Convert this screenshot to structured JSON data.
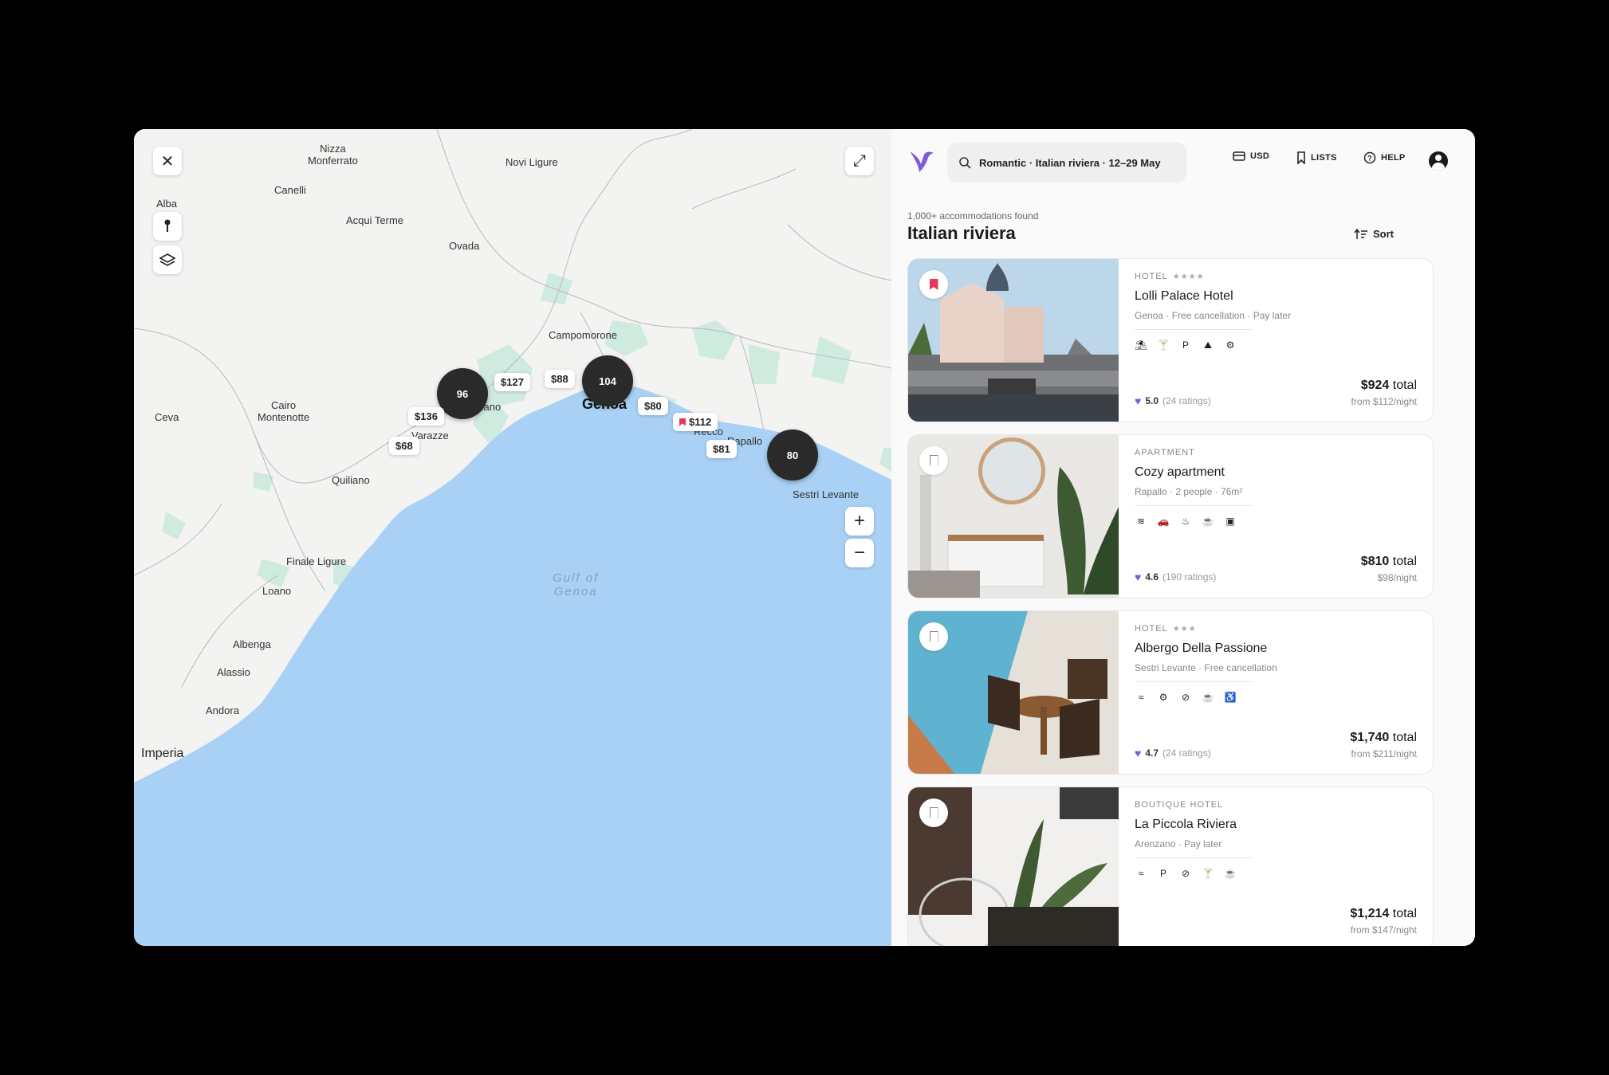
{
  "map": {
    "labels": {
      "nizza": "Nizza\nMonferrato",
      "novi": "Novi Ligure",
      "canelli": "Canelli",
      "alba": "Alba",
      "acqui": "Acqui Terme",
      "ovada": "Ovada",
      "campomorone": "Campomorone",
      "cairo": "Cairo\nMontenotte",
      "ceva": "Ceva",
      "arenzano": "zano",
      "varazze": "Varazze",
      "genoa": "Genoa",
      "recco": "Recco",
      "rapallo": "Rapallo",
      "sestri": "Sestri Levante",
      "quiliano": "Quiliano",
      "finale": "Finale Ligure",
      "loano": "Loano",
      "albenga": "Albenga",
      "alassio": "Alassio",
      "andora": "Andora",
      "imperia": "Imperia",
      "gulf": "Gulf of\nGenoa"
    },
    "clusters": [
      "96",
      "104",
      "80"
    ],
    "prices": [
      "$127",
      "$88",
      "$80",
      "$112",
      "$136",
      "$68",
      "$81"
    ],
    "controls": {
      "close": "✕",
      "expand": "⤢",
      "zoom_in": "+",
      "zoom_out": "−"
    }
  },
  "topbar": {
    "search": "Romantic · Italian riviera · 12–29 May",
    "currency": "USD",
    "lists": "LISTS",
    "help": "HELP"
  },
  "results": {
    "count": "1,000+ accommodations found",
    "region": "Italian riviera",
    "sort": "Sort"
  },
  "listings": [
    {
      "type": "HOTEL",
      "stars": "★★★★",
      "name": "Lolli Palace Hotel",
      "meta": "Genoa · Free cancellation · Pay later",
      "amenities": [
        "⛱",
        "🍸",
        "P",
        "⛰",
        "⚙"
      ],
      "score": "5.0",
      "ratings": "(24 ratings)",
      "total": "$924",
      "total_suffix": "total",
      "night": "from $112/night",
      "saved": true
    },
    {
      "type": "APARTMENT",
      "stars": "",
      "name": "Cozy apartment",
      "meta": "Rapallo · 2 people · 76m²",
      "amenities": [
        "≋",
        "🚗",
        "♨",
        "☕",
        "▣"
      ],
      "score": "4.6",
      "ratings": "(190 ratings)",
      "total": "$810",
      "total_suffix": "total",
      "night": "$98/night",
      "saved": false
    },
    {
      "type": "HOTEL",
      "stars": "★★★",
      "name": "Albergo Della Passione",
      "meta": "Sestri Levante · Free cancellation",
      "amenities": [
        "≈",
        "⚙",
        "⊘",
        "☕",
        "♿"
      ],
      "score": "4.7",
      "ratings": "(24 ratings)",
      "total": "$1,740",
      "total_suffix": "total",
      "night": "from $211/night",
      "saved": false
    },
    {
      "type": "BOUTIQUE HOTEL",
      "stars": "",
      "name": "La Piccola Riviera",
      "meta": "Arenzano · Pay later",
      "amenities": [
        "≈",
        "P",
        "⊘",
        "🍸",
        "☕"
      ],
      "score": "",
      "ratings": "",
      "total": "$1,214",
      "total_suffix": "total",
      "night": "from $147/night",
      "saved": false
    }
  ],
  "colors": {
    "accent": "#7b5bd6",
    "saved": "#e8385a",
    "sea": "#a9d1f5",
    "cluster": "#2a2a2a"
  }
}
